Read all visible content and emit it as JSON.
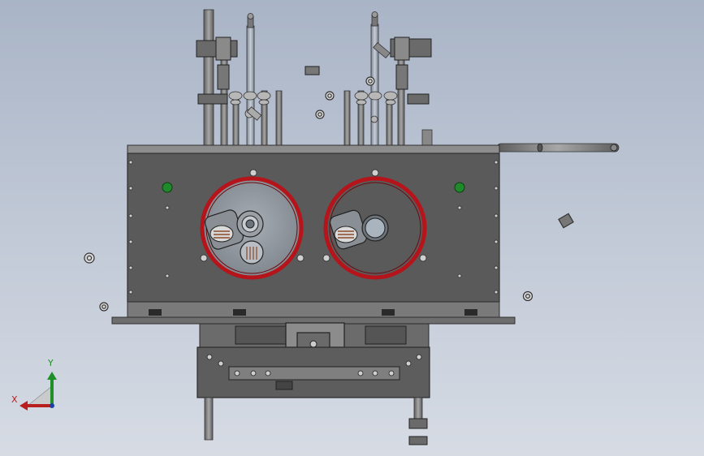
{
  "viewport": {
    "background_top": "#a9b4c6",
    "background_bottom": "#d6dbe4"
  },
  "model": {
    "plate_color": "#5a5a5a",
    "plate_edge": "#2f2f2f",
    "ring_color": "#b5141a",
    "disc_color": "#8f959c",
    "rod_color": "#7d7d7d",
    "light_color": "#1f8a2a"
  },
  "triad": {
    "y_label": "Y",
    "x_label": "X",
    "y_color": "#1f8f2a",
    "x_color": "#b81e1e"
  }
}
